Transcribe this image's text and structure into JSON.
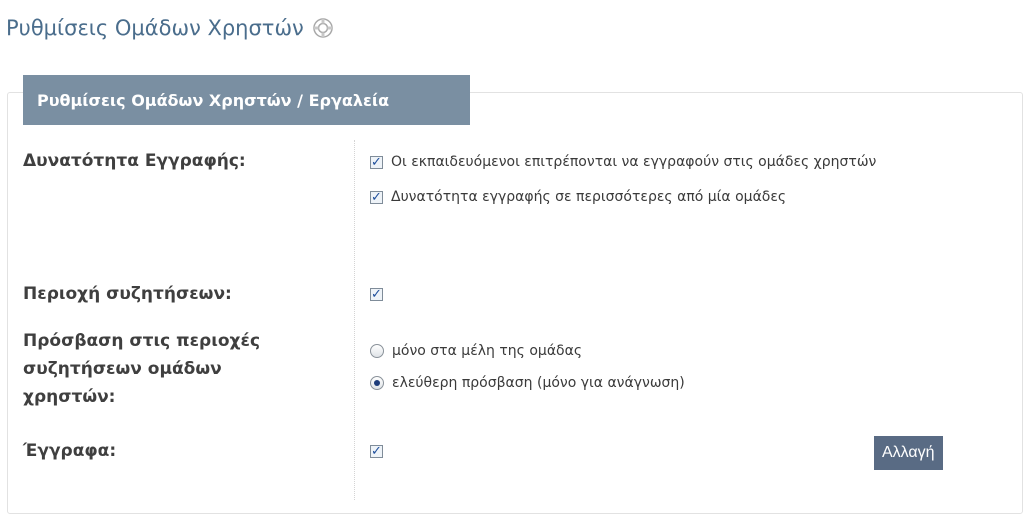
{
  "page": {
    "title": "Ρυθμίσεις Ομάδων Χρηστών"
  },
  "panel": {
    "legend": "Ρυθμίσεις Ομάδων Χρηστών / Εργαλεία"
  },
  "rows": {
    "registration": {
      "label": "Δυνατότητα Εγγραφής:",
      "options": [
        {
          "text": "Οι εκπαιδευόμενοι επιτρέπονται να εγγραφούν στις ομάδες χρηστών",
          "checked": true
        },
        {
          "text": "Δυνατότητα εγγραφής σε περισσότερες από μία ομάδες",
          "checked": true
        }
      ]
    },
    "forum": {
      "label": "Περιοχή συζητήσεων:",
      "checked": true
    },
    "forum_access": {
      "label_line1": "Πρόσβαση στις περιοχές",
      "label_line2": "συζητήσεων ομάδων",
      "label_line3": "χρηστών:",
      "options": [
        {
          "text": "μόνο στα μέλη της ομάδας",
          "selected": false
        },
        {
          "text": "ελεύθερη πρόσβαση (μόνο για ανάγνωση)",
          "selected": true
        }
      ]
    },
    "documents": {
      "label": "Έγγραφα:",
      "checked": true
    }
  },
  "actions": {
    "submit_label": "Αλλαγή"
  }
}
